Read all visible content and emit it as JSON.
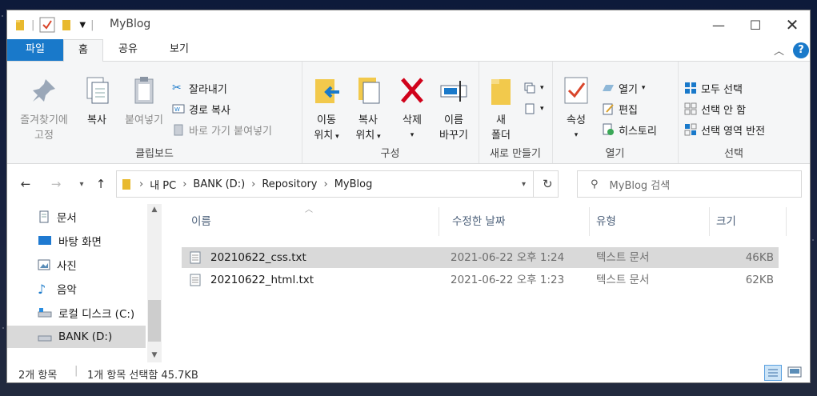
{
  "window": {
    "title": "MyBlog"
  },
  "tabs": {
    "file": "파일",
    "home": "홈",
    "share": "공유",
    "view": "보기"
  },
  "ribbon": {
    "clipboard": {
      "label": "클립보드",
      "pin": [
        "즐겨찾기에",
        "고정"
      ],
      "copy": "복사",
      "paste": "붙여넣기",
      "cut": "잘라내기",
      "copy_path": "경로 복사",
      "paste_shortcut": "바로 가기 붙여넣기"
    },
    "organize": {
      "label": "구성",
      "move": [
        "이동",
        "위치"
      ],
      "copyto": [
        "복사",
        "위치"
      ],
      "delete": "삭제",
      "rename": [
        "이름",
        "바꾸기"
      ]
    },
    "new": {
      "label": "새로 만들기",
      "folder": [
        "새",
        "폴더"
      ]
    },
    "open": {
      "label": "열기",
      "properties": "속성",
      "open": "열기",
      "edit": "편집",
      "history": "히스토리"
    },
    "select": {
      "label": "선택",
      "all": "모두 선택",
      "none": "선택 안 함",
      "invert": "선택 영역 반전"
    }
  },
  "address": {
    "crumbs": [
      "내 PC",
      "BANK (D:)",
      "Repository",
      "MyBlog"
    ]
  },
  "search": {
    "placeholder": "MyBlog 검색"
  },
  "nav": {
    "items": [
      {
        "label": "문서",
        "icon": "documents-icon"
      },
      {
        "label": "바탕 화면",
        "icon": "desktop-icon"
      },
      {
        "label": "사진",
        "icon": "pictures-icon"
      },
      {
        "label": "음악",
        "icon": "music-icon"
      },
      {
        "label": "로컬 디스크 (C:)",
        "icon": "drive-icon"
      },
      {
        "label": "BANK (D:)",
        "icon": "drive-icon"
      }
    ]
  },
  "list": {
    "columns": [
      "이름",
      "수정한 날짜",
      "유형",
      "크기"
    ],
    "rows": [
      {
        "name": "20210622_css.txt",
        "date": "2021-06-22 오후 1:24",
        "type": "텍스트 문서",
        "size": "46KB",
        "selected": true
      },
      {
        "name": "20210622_html.txt",
        "date": "2021-06-22 오후 1:23",
        "type": "텍스트 문서",
        "size": "62KB",
        "selected": false
      }
    ]
  },
  "status": {
    "count": "2개 항목",
    "selection": "1개 항목 선택함 45.7KB"
  },
  "colors": {
    "accent": "#1979ca",
    "selected_row": "#d9d9d9"
  }
}
